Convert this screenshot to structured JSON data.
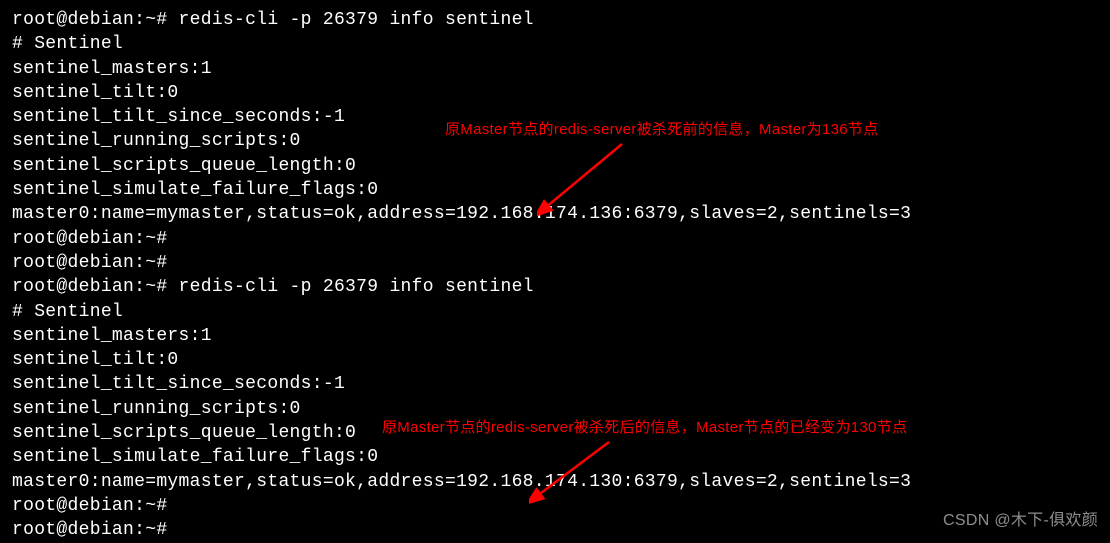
{
  "block1": {
    "prompt_line": "root@debian:~# redis-cli -p 26379 info sentinel",
    "header": "# Sentinel",
    "lines": [
      "sentinel_masters:1",
      "sentinel_tilt:0",
      "sentinel_tilt_since_seconds:-1",
      "sentinel_running_scripts:0",
      "sentinel_scripts_queue_length:0",
      "sentinel_simulate_failure_flags:0",
      "master0:name=mymaster,status=ok,address=192.168.174.136:6379,slaves=2,sentinels=3"
    ],
    "post_prompts": [
      "root@debian:~#",
      "root@debian:~#"
    ]
  },
  "block2": {
    "prompt_line": "root@debian:~# redis-cli -p 26379 info sentinel",
    "header": "# Sentinel",
    "lines": [
      "sentinel_masters:1",
      "sentinel_tilt:0",
      "sentinel_tilt_since_seconds:-1",
      "sentinel_running_scripts:0",
      "sentinel_scripts_queue_length:0",
      "sentinel_simulate_failure_flags:0",
      "master0:name=mymaster,status=ok,address=192.168.174.130:6379,slaves=2,sentinels=3"
    ],
    "post_prompts": [
      "root@debian:~#",
      "root@debian:~#"
    ]
  },
  "annotations": {
    "a1": "原Master节点的redis-server被杀死前的信息，Master为136节点",
    "a2": "原Master节点的redis-server被杀死后的信息，Master节点的已经变为130节点"
  },
  "watermark": "CSDN @木下-俱欢颜"
}
